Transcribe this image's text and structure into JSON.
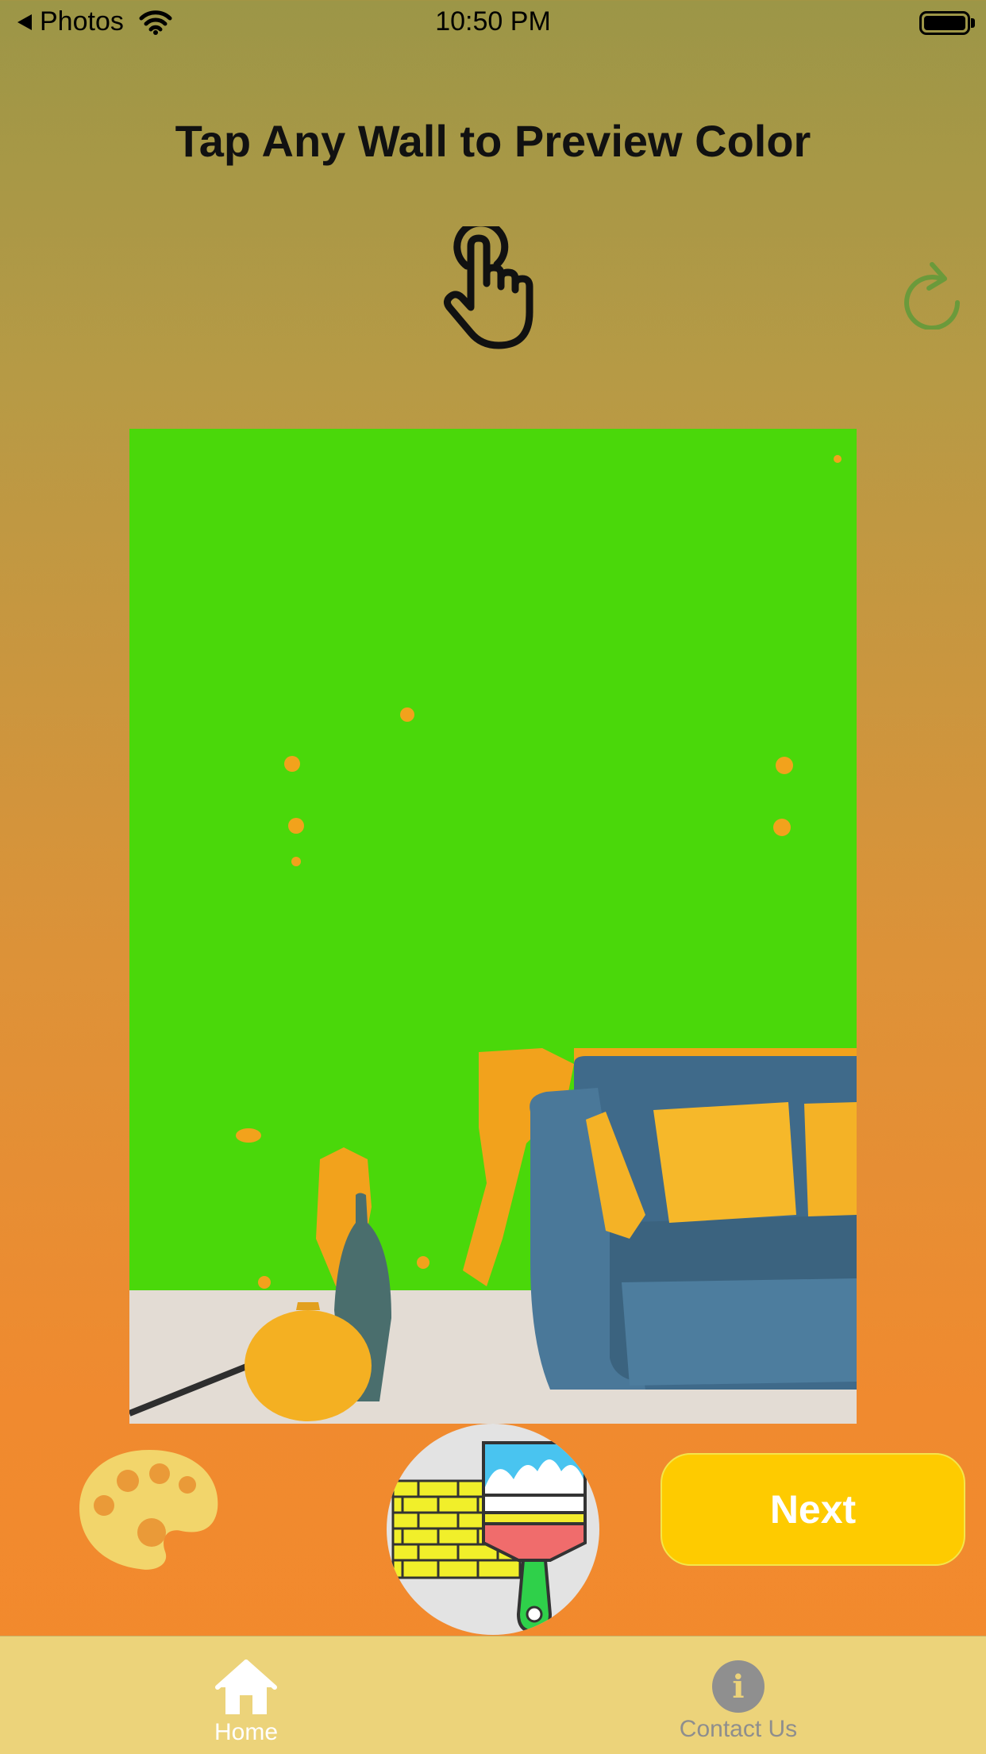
{
  "status_bar": {
    "back_label": "Photos",
    "time": "10:50 PM",
    "icons": [
      "back-arrow-icon",
      "wifi-icon",
      "battery-icon"
    ]
  },
  "header": {
    "title": "Tap Any Wall to Preview Color",
    "icons": [
      "tap-hand-icon",
      "refresh-icon"
    ]
  },
  "preview": {
    "wall_color": "#4ad80a",
    "description_icon": "room-preview-image"
  },
  "actions": {
    "palette_icon": "palette-icon",
    "center_icon": "wall-paint-brush-icon",
    "next_label": "Next"
  },
  "tab_bar": {
    "tabs": [
      {
        "label": "Home",
        "icon": "home-icon",
        "active": true
      },
      {
        "label": "Contact Us",
        "icon": "info-icon",
        "active": false
      }
    ]
  },
  "colors": {
    "accent_yellow": "#fecb00",
    "tab_bar_bg": "#ecd37a",
    "refresh_green": "#6b9a3b"
  }
}
